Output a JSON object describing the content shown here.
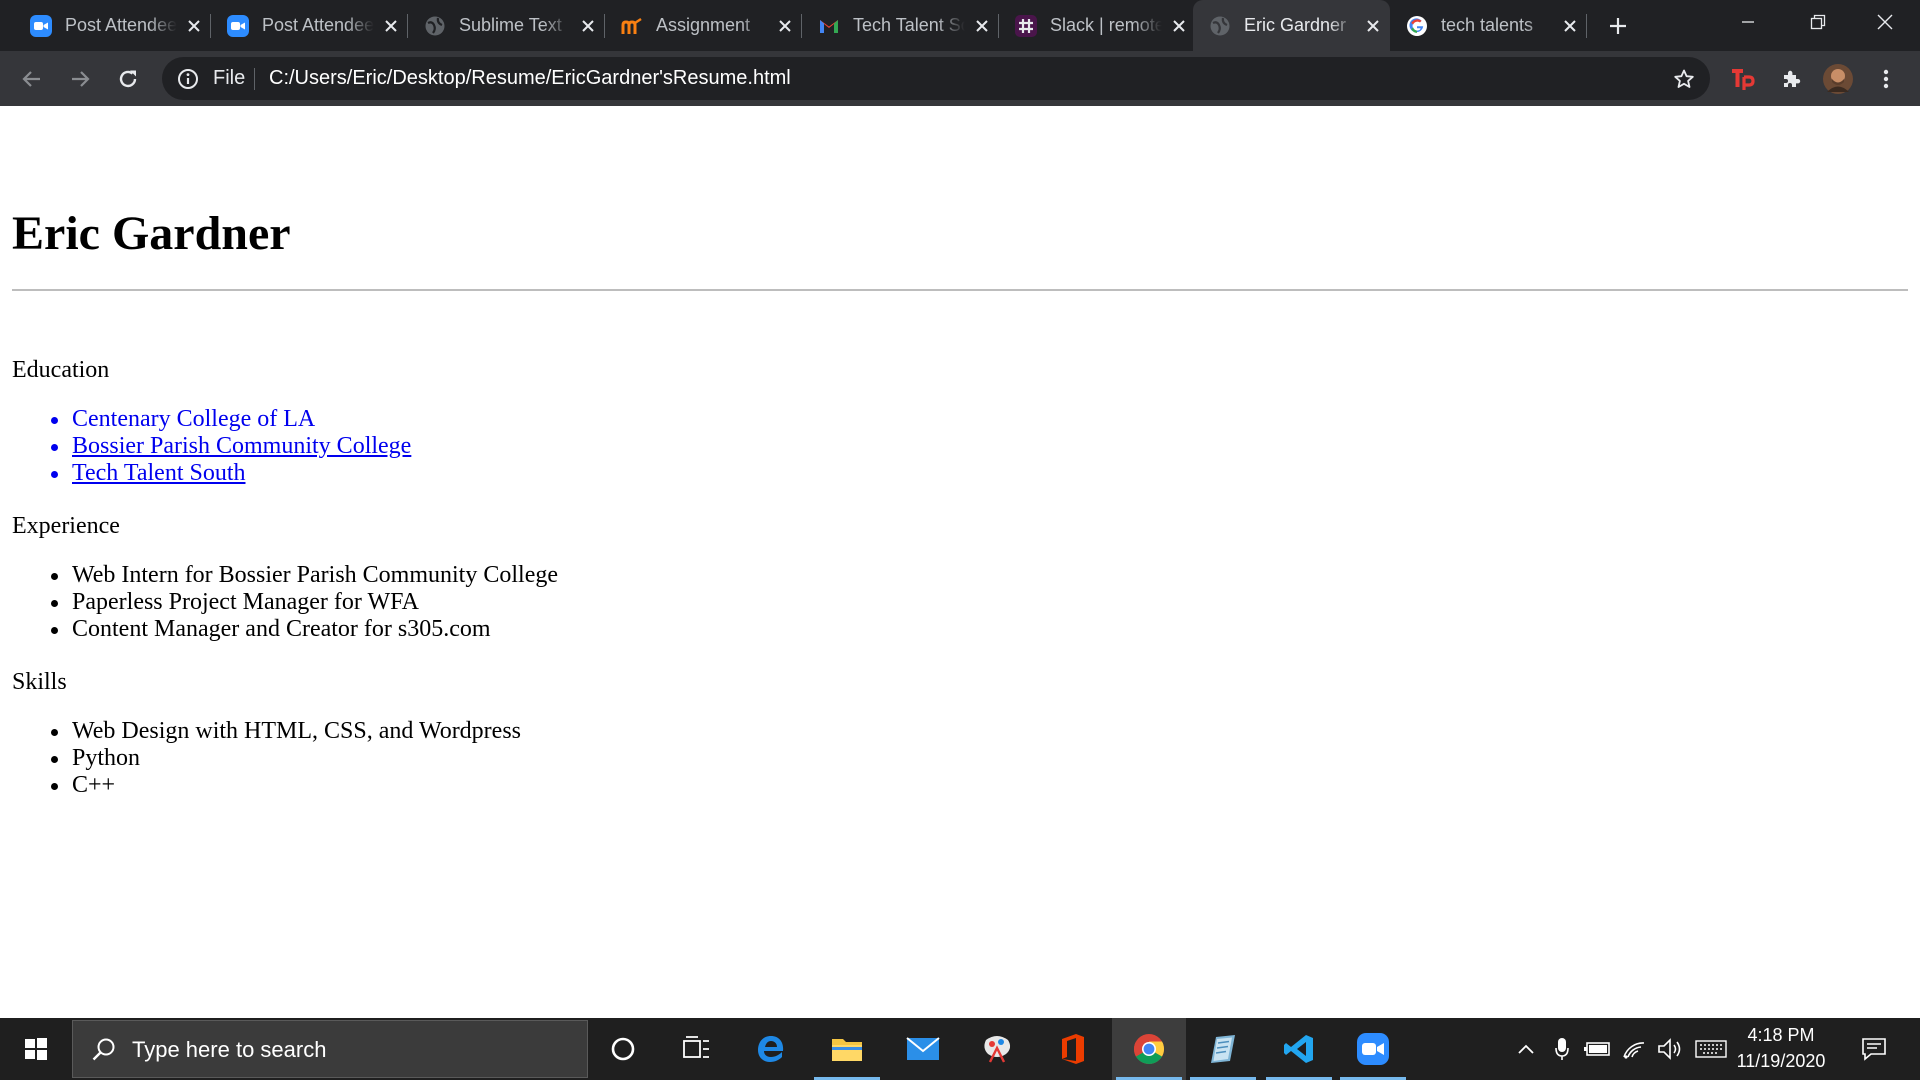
{
  "browser": {
    "tabs": [
      {
        "title": "Post Attendee - Zoom",
        "icon": "zoom-icon"
      },
      {
        "title": "Post Attendee - Zoom",
        "icon": "zoom-icon"
      },
      {
        "title": "Sublime Text",
        "icon": "globe-icon"
      },
      {
        "title": "Assignment",
        "icon": "moodle-icon"
      },
      {
        "title": "Tech Talent South",
        "icon": "gmail-icon"
      },
      {
        "title": "Slack | remote",
        "icon": "slack-icon"
      },
      {
        "title": "Eric Gardner",
        "icon": "globe-icon",
        "active": true
      },
      {
        "title": "tech talents",
        "icon": "google-icon"
      }
    ],
    "address": {
      "scheme_label": "File",
      "url": "C:/Users/Eric/Desktop/Resume/EricGardner'sResume.html"
    }
  },
  "resume": {
    "name": "Eric Gardner",
    "education_title": "Education",
    "education": [
      "Centenary College of LA",
      "Bossier Parish Community College",
      "Tech Talent South"
    ],
    "experience_title": "Experience",
    "experience": [
      "Web Intern for Bossier Parish Community College",
      "Paperless Project Manager for WFA",
      "Content Manager and Creator for s305.com"
    ],
    "skills_title": "Skills",
    "skills": [
      "Web Design with HTML, CSS, and Wordpress",
      "Python",
      "C++"
    ]
  },
  "taskbar": {
    "search_placeholder": "Type here to search",
    "time": "4:18 PM",
    "date": "11/19/2020"
  },
  "colors": {
    "link": "#0000ee",
    "tab_strip": "#202124",
    "toolbar": "#35363a",
    "taskbar": "#1f1f1f"
  }
}
